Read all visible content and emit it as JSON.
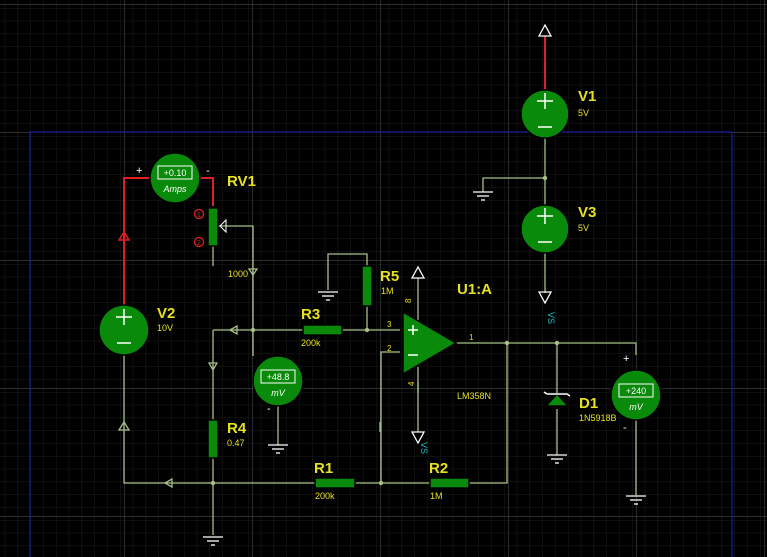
{
  "components": {
    "v1": {
      "ref": "V1",
      "value": "5V"
    },
    "v2": {
      "ref": "V2",
      "value": "10V"
    },
    "v3": {
      "ref": "V3",
      "value": "5V"
    },
    "rv1": {
      "ref": "RV1",
      "value": "1000"
    },
    "r1": {
      "ref": "R1",
      "value": "200k"
    },
    "r2": {
      "ref": "R2",
      "value": "1M"
    },
    "r3": {
      "ref": "R3",
      "value": "200k"
    },
    "r4": {
      "ref": "R4",
      "value": "0.47"
    },
    "r5": {
      "ref": "R5",
      "value": "1M"
    },
    "u1": {
      "ref": "U1:A",
      "value": "LM358N",
      "pin_plus": "3",
      "pin_minus": "2",
      "pin_out": "1",
      "pin_vcc": "8",
      "pin_gnd": "4"
    },
    "d1": {
      "ref": "D1",
      "value": "1N5918B"
    }
  },
  "meters": {
    "ammeter": {
      "reading": "+0.10",
      "unit": "Amps"
    },
    "mv1": {
      "reading": "+48.8",
      "unit": "mV"
    },
    "mv2": {
      "reading": "+240",
      "unit": "mV"
    }
  },
  "labels": {
    "vs_top": "VS",
    "vs_bottom": "VS",
    "plus": "+",
    "minus": "-"
  },
  "colors": {
    "background": "#000000",
    "grid": "#3a3a3a",
    "component_fill": "#0a8a0a",
    "wire": "#a8c088",
    "positive_wire": "#e02020",
    "label": "#e6e21c",
    "net_label": "#18c0c8",
    "border": "#1a1aa0"
  }
}
